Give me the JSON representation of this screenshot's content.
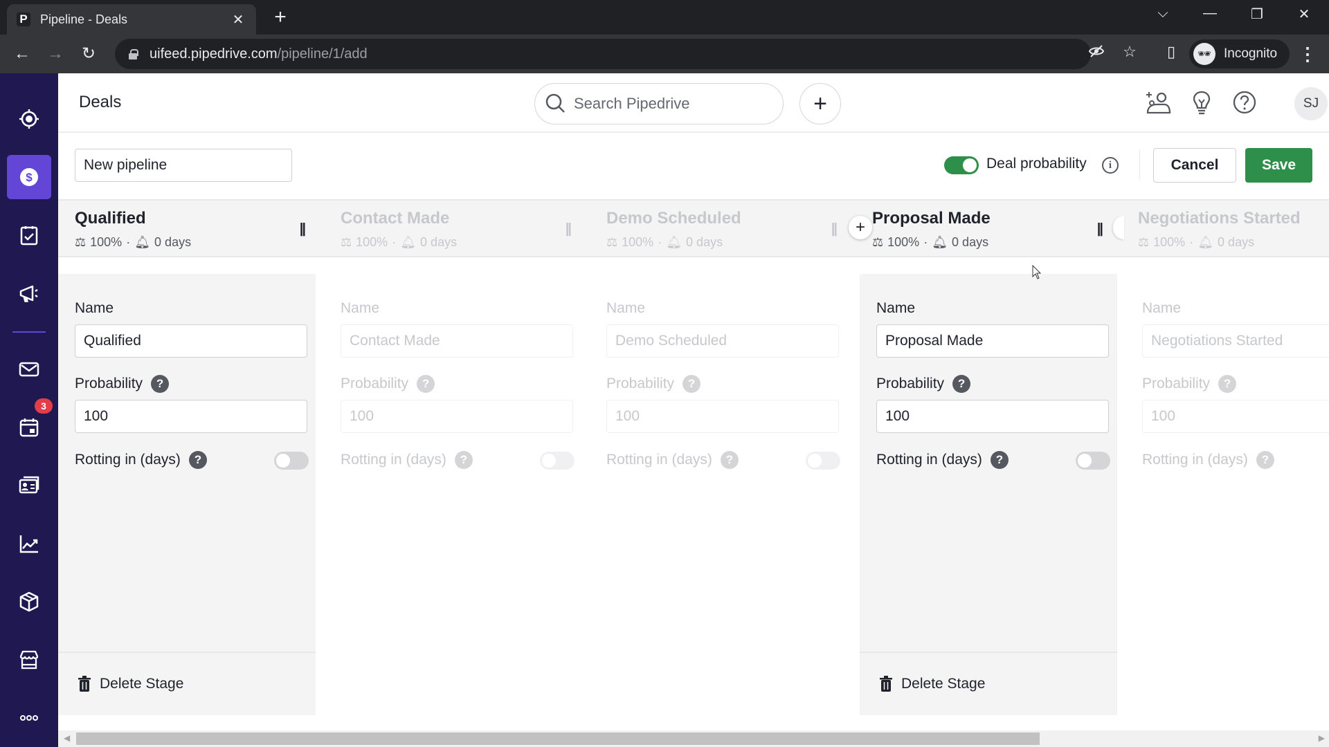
{
  "browser": {
    "tab_title": "Pipeline - Deals",
    "tab_favicon": "P",
    "url_host": "uifeed.pipedrive.com",
    "url_path": "/pipeline/1/add",
    "profile_label": "Incognito"
  },
  "sidebar": {
    "items": [
      {
        "icon": "target-icon",
        "label": "Focus"
      },
      {
        "icon": "dollar-icon",
        "label": "Deals",
        "active": true
      },
      {
        "icon": "clipboard-check-icon",
        "label": "Activities"
      },
      {
        "icon": "megaphone-icon",
        "label": "Campaigns"
      },
      {
        "icon": "mail-icon",
        "label": "Mail"
      },
      {
        "icon": "calendar-icon",
        "label": "Calendar",
        "badge": "3"
      },
      {
        "icon": "contacts-icon",
        "label": "Contacts"
      },
      {
        "icon": "chart-icon",
        "label": "Insights"
      },
      {
        "icon": "box-icon",
        "label": "Products"
      },
      {
        "icon": "store-icon",
        "label": "Marketplace"
      },
      {
        "icon": "more-icon",
        "label": "More"
      }
    ],
    "calendar_badge": "3"
  },
  "header": {
    "title": "Deals",
    "search_placeholder": "Search Pipedrive",
    "avatar_initials": "SJ"
  },
  "toolbar": {
    "pipeline_name": "New pipeline",
    "deal_probability_label": "Deal probability",
    "deal_probability_enabled": true,
    "cancel_label": "Cancel",
    "save_label": "Save"
  },
  "accent_colors": {
    "primary_green": "#2e8f4a",
    "sidebar_bg": "#201850",
    "sidebar_active": "#6346d6",
    "badge_red": "#e33d4a"
  },
  "stages": [
    {
      "name": "Qualified",
      "probability": "100%",
      "rotting": "0 days",
      "active": true,
      "name_value": "Qualified",
      "probability_value": "100",
      "rotting_enabled": false
    },
    {
      "name": "Contact Made",
      "probability": "100%",
      "rotting": "0 days",
      "active": false,
      "name_value": "Contact Made",
      "probability_value": "100",
      "rotting_enabled": false
    },
    {
      "name": "Demo Scheduled",
      "probability": "100%",
      "rotting": "0 days",
      "active": false,
      "name_value": "Demo Scheduled",
      "probability_value": "100",
      "rotting_enabled": false
    },
    {
      "name": "Proposal Made",
      "probability": "100%",
      "rotting": "0 days",
      "active": true,
      "name_value": "Proposal Made",
      "probability_value": "100",
      "rotting_enabled": false
    },
    {
      "name": "Negotiations Started",
      "probability": "100%",
      "rotting": "0 days",
      "active": false,
      "name_value": "Negotiations Started",
      "probability_value": "100",
      "rotting_enabled": false
    }
  ],
  "stage_form": {
    "name_label": "Name",
    "probability_label": "Probability",
    "rotting_label": "Rotting in (days)",
    "delete_label": "Delete Stage",
    "meta_separator": "·"
  }
}
